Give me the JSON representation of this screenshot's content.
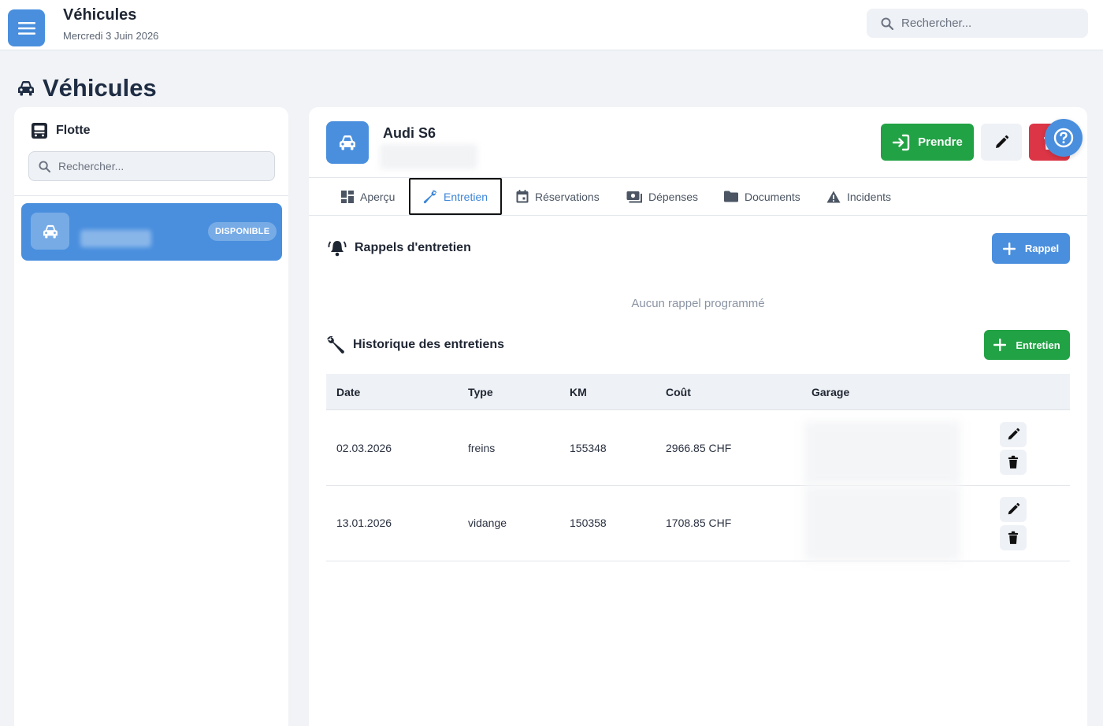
{
  "topbar": {
    "title": "Véhicules",
    "date": "Mercredi 3 Juin 2026",
    "search_placeholder": "Rechercher..."
  },
  "page": {
    "title": "Véhicules"
  },
  "sidebar": {
    "header": "Flotte",
    "search_placeholder": "Rechercher...",
    "vehicles": [
      {
        "name": "Audi S6",
        "status": "DISPONIBLE"
      }
    ]
  },
  "vehicle": {
    "name": "Audi S6",
    "actions": {
      "take_label": "Prendre"
    }
  },
  "tabs": [
    {
      "label": "Aperçu",
      "icon": "dashboard-icon"
    },
    {
      "label": "Entretien",
      "icon": "wrench-icon"
    },
    {
      "label": "Réservations",
      "icon": "calendar-icon"
    },
    {
      "label": "Dépenses",
      "icon": "money-icon"
    },
    {
      "label": "Documents",
      "icon": "folder-icon"
    },
    {
      "label": "Incidents",
      "icon": "warning-icon"
    }
  ],
  "reminders": {
    "title": "Rappels d'entretien",
    "add_label": "Rappel",
    "empty_message": "Aucun rappel programmé"
  },
  "history": {
    "title": "Historique des entretiens",
    "add_label": "Entretien",
    "columns": [
      "Date",
      "Type",
      "KM",
      "Coût",
      "Garage"
    ],
    "rows": [
      {
        "date": "02.03.2026",
        "type": "freins",
        "km": "155348",
        "cost": "2966.85 CHF"
      },
      {
        "date": "13.01.2026",
        "type": "vidange",
        "km": "150358",
        "cost": "1708.85 CHF"
      }
    ]
  },
  "colors": {
    "primary": "#4a8fde",
    "success": "#21a244",
    "danger": "#dc3545"
  }
}
